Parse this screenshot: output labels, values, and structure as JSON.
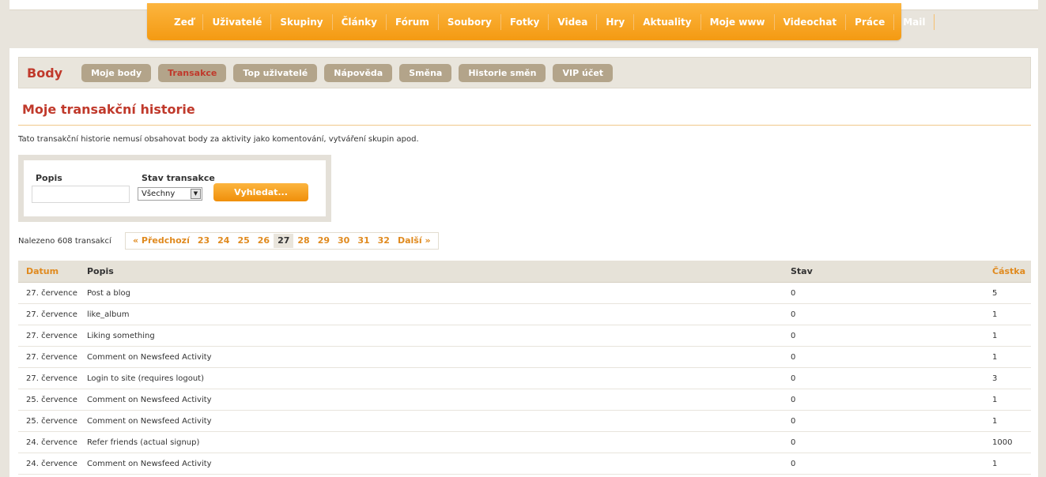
{
  "nav": [
    "Zeď",
    "Uživatelé",
    "Skupiny",
    "Články",
    "Fórum",
    "Soubory",
    "Fotky",
    "Videa",
    "Hry",
    "Aktuality",
    "Moje www",
    "Videochat",
    "Práce",
    "Mail"
  ],
  "subnav": {
    "title": "Body",
    "buttons": [
      "Moje body",
      "Transakce",
      "Top uživatelé",
      "Nápověda",
      "Směna",
      "Historie směn",
      "VIP účet"
    ],
    "active": "Transakce"
  },
  "page": {
    "title": "Moje transakční historie",
    "note": "Tato transakční historie nemusí obsahovat body za aktivity jako komentování, vytváření skupin apod."
  },
  "filter": {
    "popis_label": "Popis",
    "popis_value": "",
    "stav_label": "Stav transakce",
    "stav_value": "Všechny",
    "search_label": "Vyhledat..."
  },
  "results": {
    "found": "Nalezeno 608 transakcí",
    "pager": {
      "prev": "« Předchozí",
      "pages": [
        "23",
        "24",
        "25",
        "26",
        "27",
        "28",
        "29",
        "30",
        "31",
        "32"
      ],
      "current": "27",
      "next": "Další »"
    }
  },
  "table": {
    "headers": {
      "date": "Datum",
      "desc": "Popis",
      "stav": "Stav",
      "amount": "Částka"
    },
    "rows": [
      [
        "27. července",
        "Post a blog",
        "0",
        "5"
      ],
      [
        "27. července",
        "like_album",
        "0",
        "1"
      ],
      [
        "27. července",
        "Liking something",
        "0",
        "1"
      ],
      [
        "27. července",
        "Comment on Newsfeed Activity",
        "0",
        "1"
      ],
      [
        "27. července",
        "Login to site (requires logout)",
        "0",
        "3"
      ],
      [
        "25. července",
        "Comment on Newsfeed Activity",
        "0",
        "1"
      ],
      [
        "25. července",
        "Comment on Newsfeed Activity",
        "0",
        "1"
      ],
      [
        "24. července",
        "Refer friends (actual signup)",
        "0",
        "1000"
      ],
      [
        "24. července",
        "Comment on Newsfeed Activity",
        "0",
        "1"
      ]
    ]
  },
  "colors": {
    "accent": "#f49a12",
    "title_red": "#c0392b",
    "link_orange": "#e08a1e",
    "subnav_btn": "#b3a48a"
  }
}
